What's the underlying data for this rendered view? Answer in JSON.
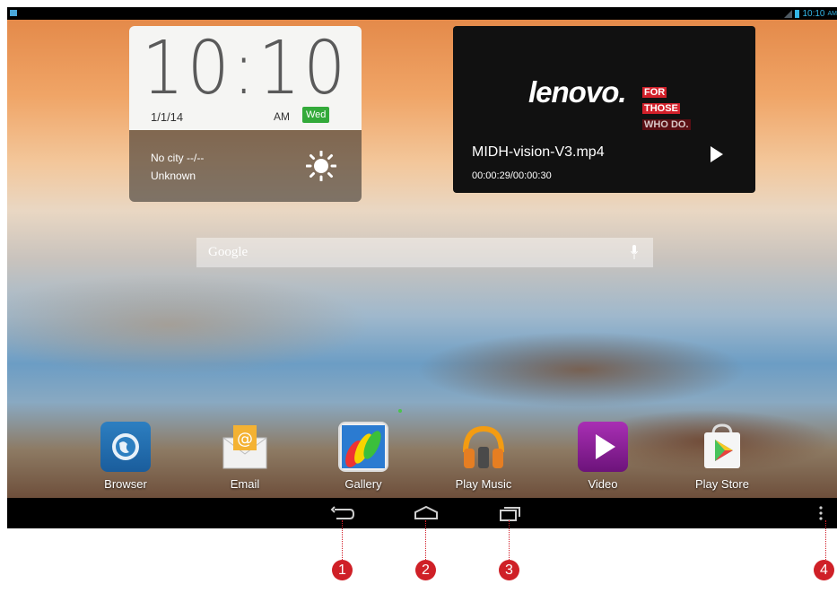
{
  "status_bar": {
    "time": "10:10",
    "time_suffix": "AM"
  },
  "clock_widget": {
    "time": "10:10",
    "date": "1/1/14",
    "ampm": "AM",
    "day": "Wed",
    "city": "No city --/--",
    "condition": "Unknown",
    "weather_icon": "sun-icon"
  },
  "video_widget": {
    "logo": "lenovo.",
    "tag_lines": [
      "FOR",
      "THOSE",
      "WHO DO."
    ],
    "title": "MIDH-vision-V3.mp4",
    "progress": "00:00:29/00:00:30"
  },
  "search": {
    "label": "Google",
    "icon": "mic-icon"
  },
  "dock": [
    {
      "label": "Browser",
      "icon": "browser-icon"
    },
    {
      "label": "Email",
      "icon": "email-icon"
    },
    {
      "label": "Gallery",
      "icon": "gallery-icon"
    },
    {
      "label": "Play Music",
      "icon": "play-music-icon"
    },
    {
      "label": "Video",
      "icon": "video-icon"
    },
    {
      "label": "Play Store",
      "icon": "play-store-icon"
    }
  ],
  "nav_bar": {
    "buttons": [
      "back-icon",
      "home-icon",
      "recent-apps-icon",
      "menu-icon"
    ]
  },
  "callouts": [
    "1",
    "2",
    "3",
    "4"
  ],
  "colors": {
    "accent": "#33b5e5",
    "callout": "#cf2027",
    "day_badge": "#33aa3a"
  }
}
